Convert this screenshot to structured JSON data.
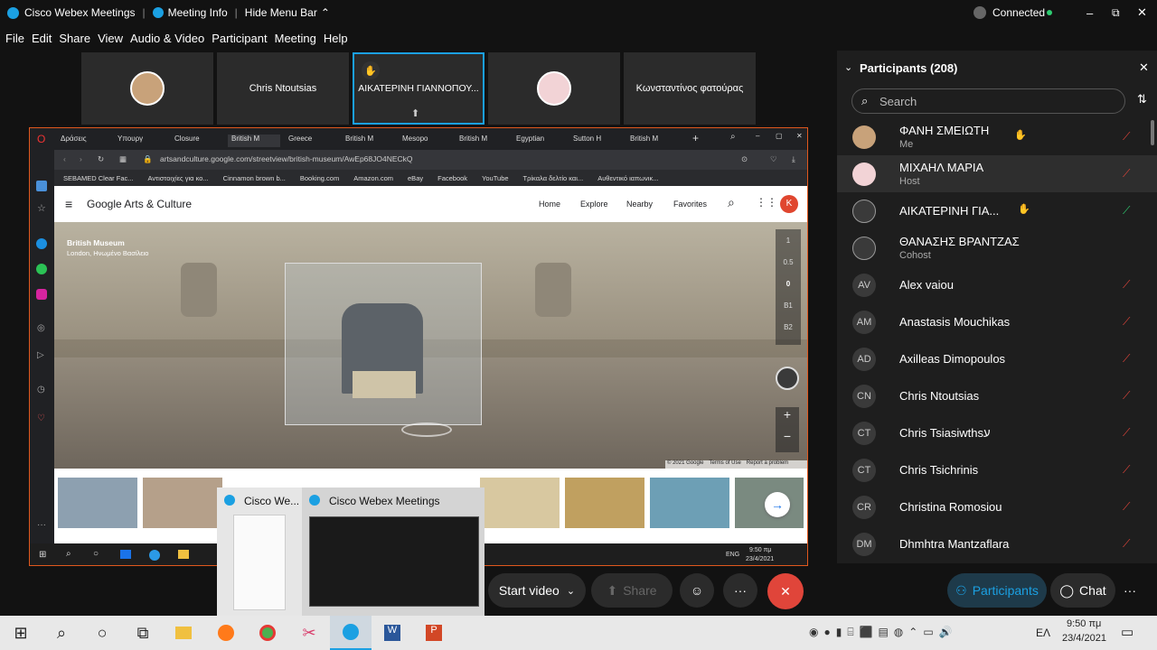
{
  "titlebar": {
    "app": "Cisco Webex Meetings",
    "meeting_info": "Meeting Info",
    "hide_menu": "Hide Menu Bar",
    "status": "Connected"
  },
  "menu": {
    "items": [
      "File",
      "Edit",
      "Share",
      "View",
      "Audio & Video",
      "Participant",
      "Meeting",
      "Help"
    ]
  },
  "tiles": {
    "t2": "Chris Ntoutsias",
    "t3": "ΑΙΚΑΤΕΡΙΝΗ ΓΙΑΝΝΟΠΟΥ...",
    "t5": "Κωνσταντίνος φατούρας"
  },
  "browser": {
    "tabs": [
      "Δράσεις",
      "Υπουργ",
      "Closure",
      "British M",
      "Greece",
      "British M",
      "Mesopo",
      "British M",
      "Egyptian",
      "Sutton H",
      "British M"
    ],
    "url": "artsandculture.google.com/streetview/british-museum/AwEp68JO4NECkQ",
    "bookmarks": [
      "SEBAMED Clear Fac...",
      "Αντιστοιχίες για κο...",
      "Cinnamon brown b...",
      "Booking.com",
      "Amazon.com",
      "eBay",
      "Facebook",
      "YouTube",
      "Τρίκαλα δελτίο και...",
      "Αυθεντικό ιαπωνικ..."
    ],
    "site_title": "Google Arts & Culture",
    "nav": [
      "Home",
      "Explore",
      "Nearby",
      "Favorites"
    ],
    "profile": "K",
    "place": "British Museum",
    "place_sub": "London, Ηνωμένο Βασίλειο",
    "floors": [
      "1",
      "0.5",
      "0",
      "B1",
      "B2"
    ],
    "copyright": "© 2021 Google",
    "terms": "Terms of Use",
    "report": "Report a problem"
  },
  "inner_taskbar": {
    "lang": "ENG",
    "time": "9:50 πμ",
    "date": "23/4/2021"
  },
  "thumbs": {
    "a": "Cisco We...",
    "b": "Cisco Webex Meetings"
  },
  "controls": {
    "start_video": "Start video",
    "share": "Share",
    "participants": "Participants",
    "chat": "Chat"
  },
  "panel": {
    "title": "Participants (208)",
    "search_placeholder": "Search",
    "people": [
      {
        "initials": "",
        "name": "ΦΑΝΗ ΣΜΕΙΩΤΗ",
        "sub": "Me"
      },
      {
        "initials": "",
        "name": "ΜΙΧΑΗΛ ΜΑΡΙΑ",
        "sub": "Host"
      },
      {
        "initials": "",
        "name": "ΑΙΚΑΤΕΡΙΝΗ ΓΙΑ...",
        "sub": ""
      },
      {
        "initials": "",
        "name": "ΘΑΝΑΣΗΣ ΒΡΑΝΤΖΑΣ",
        "sub": "Cohost"
      },
      {
        "initials": "AV",
        "name": "Alex vaiou",
        "sub": ""
      },
      {
        "initials": "AM",
        "name": "Anastasis Mouchikas",
        "sub": ""
      },
      {
        "initials": "AD",
        "name": "Axilleas Dimopoulos",
        "sub": ""
      },
      {
        "initials": "CN",
        "name": "Chris Ntoutsias",
        "sub": ""
      },
      {
        "initials": "CT",
        "name": "Chris Tsiasiwthsע",
        "sub": ""
      },
      {
        "initials": "CT",
        "name": "Chris Tsichrinis",
        "sub": ""
      },
      {
        "initials": "CR",
        "name": "Christina Romosiou",
        "sub": ""
      },
      {
        "initials": "DM",
        "name": "Dhmhtra Mantzaflara",
        "sub": ""
      }
    ]
  },
  "win_taskbar": {
    "lang": "ΕΛ",
    "time": "9:50 πμ",
    "date": "23/4/2021"
  },
  "colors": {
    "accent": "#1ba0e2",
    "orange": "#e0581e",
    "red": "#e0453a",
    "green": "#2ecc71"
  }
}
